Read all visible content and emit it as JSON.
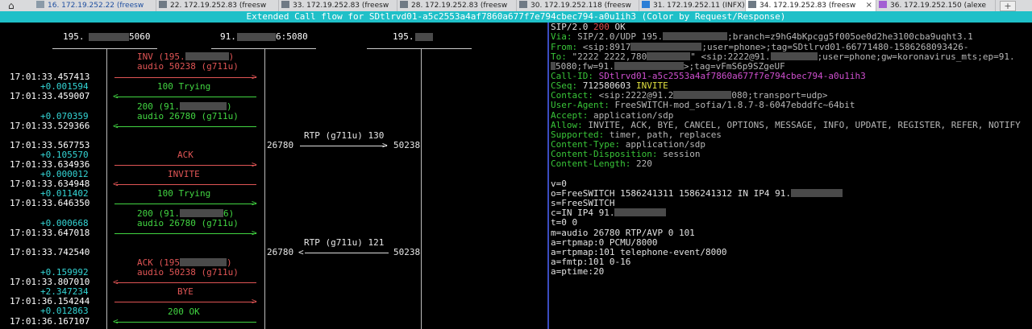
{
  "tabs": [
    {
      "label": "16. 172.19.252.22 (freesw"
    },
    {
      "label": "22. 172.19.252.83 (freesw"
    },
    {
      "label": "33. 172.19.252.83 (freesw"
    },
    {
      "label": "28. 172.19.252.83 (freesw"
    },
    {
      "label": "30. 172.19.252.118 (freesw"
    },
    {
      "label": "31. 172.19.252.11 (INFX)"
    },
    {
      "label": "34. 172.19.252.83 (freesw"
    },
    {
      "label": "36. 172.19.252.150 (alexe"
    }
  ],
  "tab_close": "×",
  "new_tab": "+",
  "home_icon": "⌂",
  "title": "Extended Call flow for SDtlrvd01-a5c2553a4af7860a677f7e794cbec794-a0u1ih3 (Color by Request/Response)",
  "hosts": [
    "195.",
    "5060",
    "91.",
    "6:5080",
    "195."
  ],
  "flow": {
    "inv_label_a": "INV (195.",
    "inv_label_b": ")",
    "inv_audio": "audio 50238 (g711u)",
    "trying1": "100 Trying",
    "ok200_a": "200 (91.",
    "ok200_b": ")",
    "ok200_audio": "audio 26780 (g711u)",
    "ack": "ACK",
    "invite": "INVITE",
    "trying2": "100 Trying",
    "ok200b_a": "200 (91.",
    "ok200b_b": "6)",
    "ok200b_audio": "audio 26780 (g711u)",
    "ack2_a": "ACK (195",
    "ack2_b": ")",
    "ack2_audio": "audio 50238 (g711u)",
    "bye": "BYE",
    "ok200c": "200 OK",
    "rtp1_label": "RTP (g711u) 130",
    "rtp1_left": "26780",
    "rtp1_right": "50238",
    "rtp2_label": "RTP (g711u) 121",
    "rtp2_left": "26780",
    "rtp2_right": "50238"
  },
  "timestamps": [
    {
      "t": "17:01:33.457413"
    },
    {
      "d": "+0.001594"
    },
    {
      "t": "17:01:33.459007"
    },
    {
      "d": "+0.070359"
    },
    {
      "t": "17:01:33.529366"
    },
    {
      "t": "17:01:33.567753"
    },
    {
      "d": "+0.105570"
    },
    {
      "t": "17:01:33.634936"
    },
    {
      "d": "+0.000012"
    },
    {
      "t": "17:01:33.634948"
    },
    {
      "d": "+0.011402"
    },
    {
      "t": "17:01:33.646350"
    },
    {
      "d": "+0.000668"
    },
    {
      "t": "17:01:33.647018"
    },
    {
      "t": "17:01:33.742540"
    },
    {
      "d": "+0.159992"
    },
    {
      "t": "17:01:33.807010"
    },
    {
      "d": "+2.347234"
    },
    {
      "t": "17:01:36.154244"
    },
    {
      "d": "+0.012863"
    },
    {
      "t": "17:01:36.167107"
    }
  ],
  "sip": {
    "status_a": "SIP/2.0 ",
    "status_code": "200",
    "status_b": " OK",
    "via_k": "Via: ",
    "via_v1": "SIP/2.0/UDP 195.",
    "via_v2": ";branch=z9hG4bKpcgg5f005oe0d2he3100cba9uqht3.1",
    "from_k": "From: ",
    "from_v1": "<sip:8917",
    "from_v2": ";user=phone>;tag=SDtlrvd01-66771480-1586268093426-",
    "to_k": "To: ",
    "to_v1": "\"2222 2222,780",
    "to_v2": "\" <sip:2222@91.",
    "to_v3": ";user=phone;gw=koronavirus_mts;ep=91.",
    "to_cont_a": "5080;fw=91.",
    "to_cont_b": ">;tag=vFmS6p9SZgeUF",
    "callid_k": "Call-ID: ",
    "callid_v": "SDtlrvd01-a5c2553a4af7860a677f7e794cbec794-a0u1ih3",
    "cseq_k": "CSeq: ",
    "cseq_v1": "712580603 ",
    "cseq_v2": "INVITE",
    "contact_k": "Contact: ",
    "contact_v1": "<sip:2222@91.2",
    "contact_v2": "080;transport=udp>",
    "ua_k": "User-Agent: ",
    "ua_v": "FreeSWITCH-mod_sofia/1.8.7-8-6047ebddfc~64bit",
    "accept_k": "Accept: ",
    "accept_v": "application/sdp",
    "allow_k": "Allow: ",
    "allow_v": "INVITE, ACK, BYE, CANCEL, OPTIONS, MESSAGE, INFO, UPDATE, REGISTER, REFER, NOTIFY",
    "supported_k": "Supported: ",
    "supported_v": "timer, path, replaces",
    "ctype_k": "Content-Type: ",
    "ctype_v": "application/sdp",
    "cdisp_k": "Content-Disposition: ",
    "cdisp_v": "session",
    "clen_k": "Content-Length: ",
    "clen_v": "220"
  },
  "sdp": [
    "v=0",
    "o=FreeSWITCH 1586241311 1586241312 IN IP4 91.",
    "s=FreeSWITCH",
    "c=IN IP4 91.",
    "t=0 0",
    "m=audio 26780 RTP/AVP 0 101",
    "a=rtpmap:0 PCMU/8000",
    "a=rtpmap:101 telephone-event/8000",
    "a=fmtp:101 0-16",
    "a=ptime:20"
  ],
  "colors": {
    "title_bar": "#1fc0c8",
    "request": "#e05555",
    "response": "#42d642",
    "delta": "#34d6d6",
    "divider": "#3b4cc0",
    "header_key": "#39c639"
  }
}
